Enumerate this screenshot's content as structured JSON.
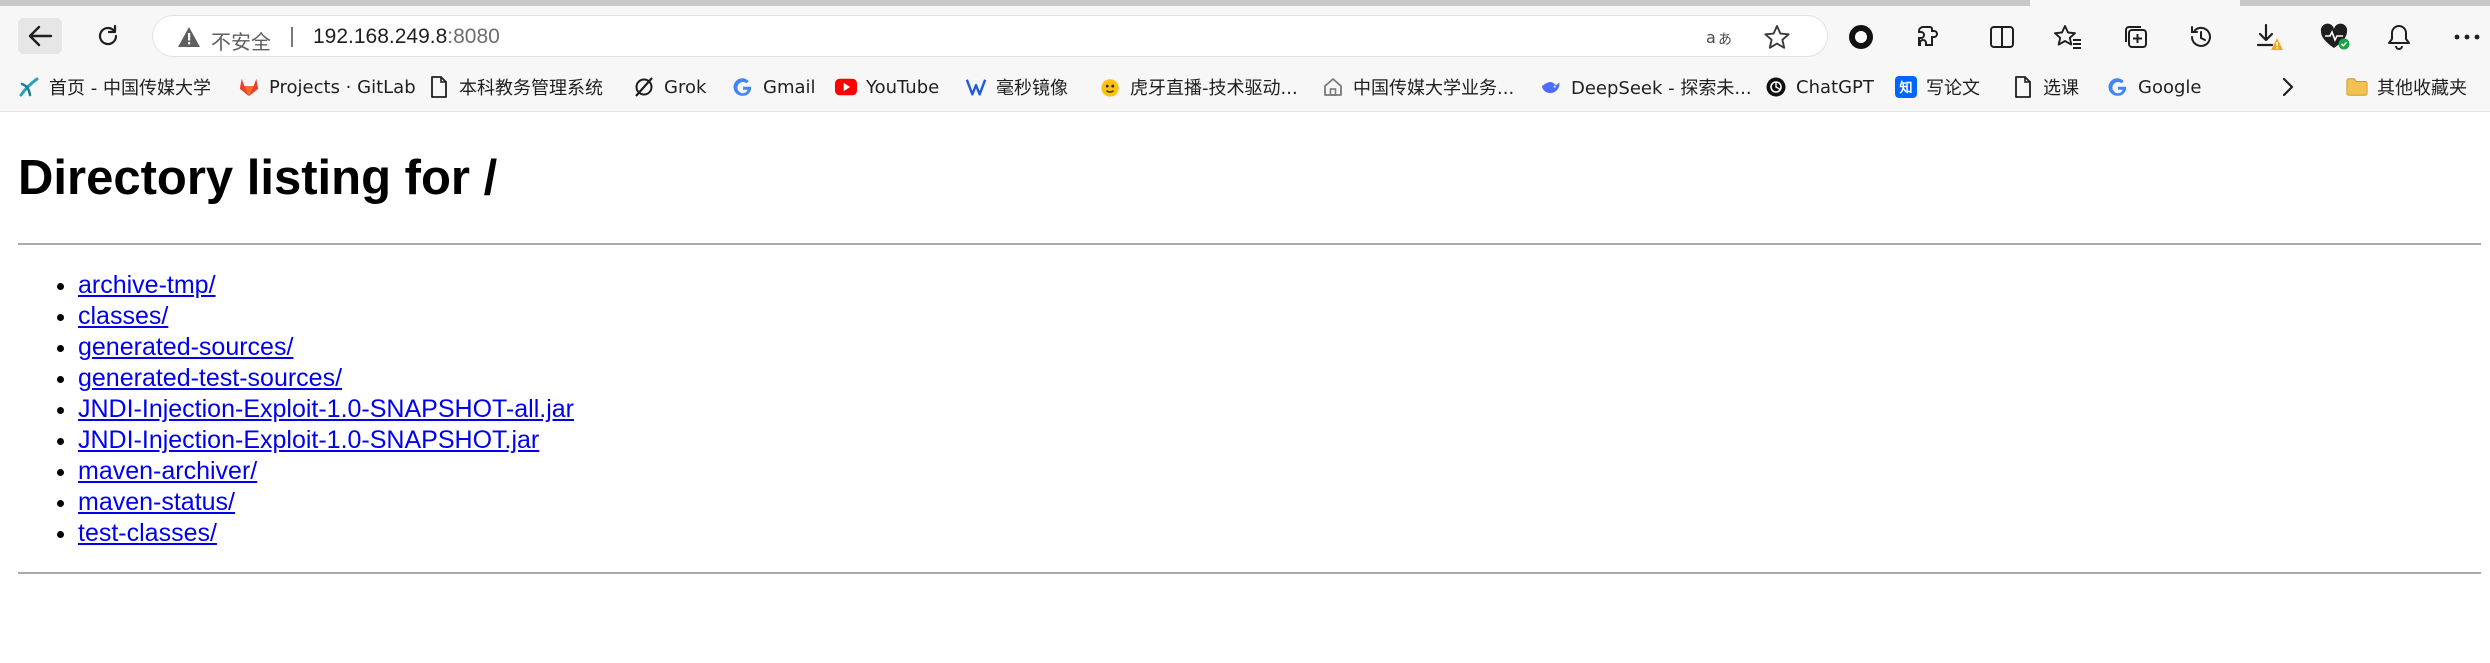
{
  "browser": {
    "address": {
      "insecure_label": "不安全",
      "host": "192.168.249.8",
      "port": ":8080"
    },
    "toolbar_icons": [
      "back-icon",
      "reload-icon",
      "warning-icon",
      "read-aloud-icon",
      "favorite-star-icon",
      "record-icon",
      "extensions-icon",
      "split-screen-icon",
      "favorites-icon",
      "collections-icon",
      "history-icon",
      "downloads-icon",
      "browser-essentials-icon",
      "notifications-icon",
      "more-icon"
    ],
    "bookmarks": [
      {
        "label": "首页 - 中国传媒大学",
        "icon": "cuc-icon"
      },
      {
        "label": "Projects · GitLab",
        "icon": "gitlab-icon"
      },
      {
        "label": "本科教务管理系统",
        "icon": "page-icon"
      },
      {
        "label": "Grok",
        "icon": "grok-icon"
      },
      {
        "label": "Gmail",
        "icon": "google-icon"
      },
      {
        "label": "YouTube",
        "icon": "youtube-icon"
      },
      {
        "label": "毫秒镜像",
        "icon": "mirror-icon"
      },
      {
        "label": "虎牙直播-技术驱动...",
        "icon": "huya-icon"
      },
      {
        "label": "中国传媒大学业务...",
        "icon": "home-icon"
      },
      {
        "label": "DeepSeek - 探索未...",
        "icon": "deepseek-icon"
      },
      {
        "label": "ChatGPT",
        "icon": "chatgpt-icon"
      },
      {
        "label": "写论文",
        "icon": "zhihu-icon"
      },
      {
        "label": "选课",
        "icon": "page-icon"
      },
      {
        "label": "Google",
        "icon": "google-icon"
      }
    ],
    "other_bookmarks": "其他收藏夹",
    "colors": {
      "link": "#0000ee",
      "youtube": "#ff0000",
      "gitlab": "#e24329",
      "zhihu": "#0066ff",
      "folder": "#f2c14e"
    }
  },
  "page": {
    "title": "Directory listing for /",
    "entries": [
      "archive-tmp/",
      "classes/",
      "generated-sources/",
      "generated-test-sources/",
      "JNDI-Injection-Exploit-1.0-SNAPSHOT-all.jar",
      "JNDI-Injection-Exploit-1.0-SNAPSHOT.jar",
      "maven-archiver/",
      "maven-status/",
      "test-classes/"
    ]
  }
}
